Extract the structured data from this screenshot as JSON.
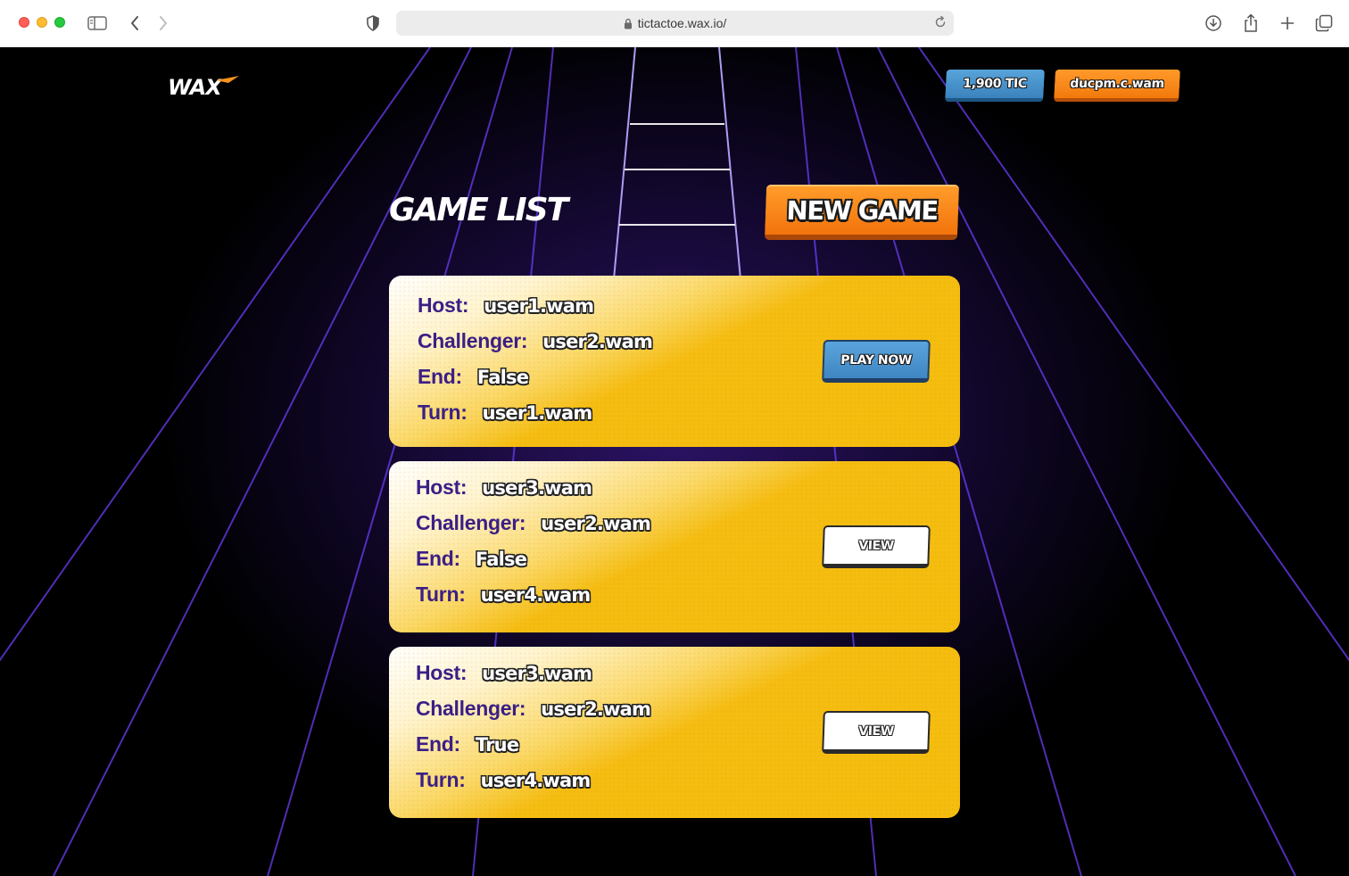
{
  "browser": {
    "url": "tictactoe.wax.io/"
  },
  "header": {
    "logo": "WAX",
    "balance": "1,900 TIC",
    "account": "ducpm.c.wam"
  },
  "page_title": "GAME LIST",
  "new_game_label": "NEW GAME",
  "labels": {
    "host": "Host:",
    "challenger": "Challenger:",
    "end": "End:",
    "turn": "Turn:"
  },
  "games": [
    {
      "host": "user1.wam",
      "challenger": "user2.wam",
      "end": "False",
      "turn": "user1.wam",
      "action": "PLAY NOW"
    },
    {
      "host": "user3.wam",
      "challenger": "user2.wam",
      "end": "False",
      "turn": "user4.wam",
      "action": "VIEW"
    },
    {
      "host": "user3.wam",
      "challenger": "user2.wam",
      "end": "True",
      "turn": "user4.wam",
      "action": "VIEW"
    }
  ],
  "colors": {
    "card": "#f5bd0d",
    "label": "#3b1f86",
    "grid": "#6b3cf0",
    "orange": "#f3730c",
    "blue": "#3f86c2"
  }
}
